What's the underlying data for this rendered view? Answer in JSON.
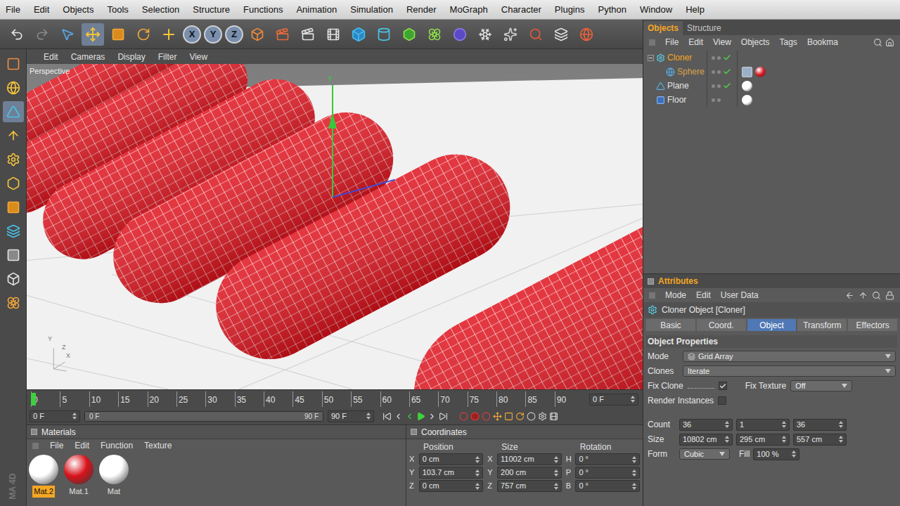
{
  "menu_bar": [
    "File",
    "Edit",
    "Objects",
    "Tools",
    "Selection",
    "Structure",
    "Functions",
    "Animation",
    "Simulation",
    "Render",
    "MoGraph",
    "Character",
    "Plugins",
    "Python",
    "Window",
    "Help"
  ],
  "toolbar": {
    "axis_buttons": [
      "X",
      "Y",
      "Z"
    ]
  },
  "viewport": {
    "menu": [
      "Edit",
      "Cameras",
      "Display",
      "Filter",
      "View"
    ],
    "label": "Perspective",
    "gizmo_label": "Y",
    "axis_labels": [
      "Y",
      "Z",
      "X"
    ]
  },
  "timeline": {
    "ticks": [
      "0",
      "5",
      "10",
      "15",
      "20",
      "25",
      "30",
      "35",
      "40",
      "45",
      "50",
      "55",
      "60",
      "65",
      "70",
      "75",
      "80",
      "85",
      "90"
    ],
    "current_frame": "0 F",
    "current_level": 0,
    "start": "0 F",
    "range_start": "0 F",
    "range_end": "90 F",
    "range_level": 1,
    "end": "90 F"
  },
  "materials": {
    "title": "Materials",
    "menu": [
      "File",
      "Edit",
      "Function",
      "Texture"
    ],
    "items": [
      {
        "name": "Mat.2",
        "selected": true,
        "color": "#ffffff"
      },
      {
        "name": "Mat.1",
        "selected": false,
        "color": "#d8131b"
      },
      {
        "name": "Mat",
        "selected": false,
        "color": "#ffffff"
      }
    ]
  },
  "coordinates": {
    "title": "Coordinates",
    "columns": [
      "Position",
      "Size",
      "Rotation"
    ],
    "rows": [
      {
        "position": {
          "axis": "X",
          "value": "0 cm"
        },
        "size": {
          "axis": "X",
          "value": "11002 cm"
        },
        "rotation": {
          "axis": "H",
          "value": "0 °"
        }
      },
      {
        "position": {
          "axis": "Y",
          "value": "103.7 cm"
        },
        "size": {
          "axis": "Y",
          "value": "200 cm"
        },
        "rotation": {
          "axis": "P",
          "value": "0 °"
        }
      },
      {
        "position": {
          "axis": "Z",
          "value": "0 cm"
        },
        "size": {
          "axis": "Z",
          "value": "757 cm"
        },
        "rotation": {
          "axis": "B",
          "value": "0 °"
        }
      }
    ]
  },
  "object_manager": {
    "tabs": [
      {
        "label": "Objects",
        "selected": true
      },
      {
        "label": "Structure",
        "selected": false
      }
    ],
    "menu": [
      "File",
      "Edit",
      "View",
      "Objects",
      "Tags",
      "Bookma"
    ],
    "objects": [
      {
        "name": "Cloner",
        "kind": "cloner",
        "depth": 0,
        "expanded": true,
        "selected": true,
        "child_of_selected": false,
        "enabled": true,
        "tags": []
      },
      {
        "name": "Sphere",
        "kind": "sphere",
        "depth": 1,
        "expanded": false,
        "selected": false,
        "child_of_selected": true,
        "enabled": true,
        "tags": [
          {
            "kind": "phong",
            "color": "#9ab0c8"
          },
          {
            "kind": "material",
            "color": "#d8131b"
          }
        ]
      },
      {
        "name": "Plane",
        "kind": "plane",
        "depth": 0,
        "expanded": false,
        "selected": false,
        "child_of_selected": false,
        "enabled": true,
        "tags": [
          {
            "kind": "material",
            "color": "#ffffff"
          }
        ]
      },
      {
        "name": "Floor",
        "kind": "floor",
        "depth": 0,
        "expanded": false,
        "selected": false,
        "child_of_selected": false,
        "enabled": false,
        "tags": [
          {
            "kind": "material",
            "color": "#ffffff"
          }
        ]
      }
    ]
  },
  "attributes": {
    "title": "Attributes",
    "menu": [
      "Mode",
      "Edit",
      "User Data"
    ],
    "object_title": "Cloner Object [Cloner]",
    "tabs": [
      {
        "label": "Basic",
        "selected": false
      },
      {
        "label": "Coord.",
        "selected": false
      },
      {
        "label": "Object",
        "selected": true
      },
      {
        "label": "Transform",
        "selected": false
      },
      {
        "label": "Effectors",
        "selected": false
      }
    ],
    "section": "Object Properties",
    "mode": {
      "label": "Mode",
      "value": "Grid Array"
    },
    "clones": {
      "label": "Clones",
      "value": "Iterate"
    },
    "fix_clone": {
      "label": "Fix Clone",
      "checked": true
    },
    "fix_texture": {
      "label": "Fix Texture",
      "value": "Off"
    },
    "render_instances": {
      "label": "Render Instances",
      "checked": false
    },
    "count": {
      "label": "Count",
      "values": [
        "36",
        "1",
        "36"
      ]
    },
    "size": {
      "label": "Size",
      "values": [
        "10802 cm",
        "295 cm",
        "557 cm"
      ]
    },
    "form": {
      "label": "Form",
      "value": "Cubic"
    },
    "fill": {
      "label": "Fill",
      "value": "100 %"
    }
  },
  "watermark": "MA 4D"
}
